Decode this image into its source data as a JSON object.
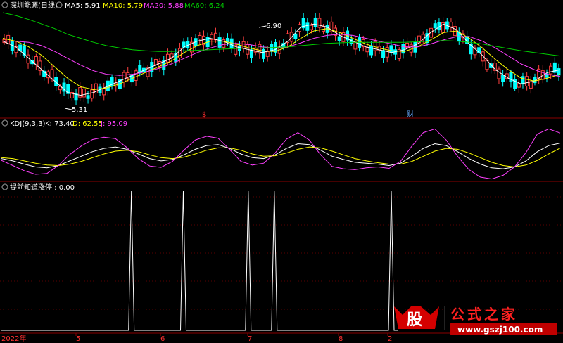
{
  "price_panel": {
    "title": "深圳能源(日线)",
    "ma5_label": "MA5: 5.91",
    "ma10_label": "MA10: 5.79",
    "ma20_label": "MA20: 5.88",
    "ma60_label": "MA60: 6.24",
    "high_marker": "6.90",
    "low_marker": "5.31",
    "event_marker_left": "$",
    "event_marker_right": "财",
    "colors": {
      "ma5": "#ffffff",
      "ma10": "#ffff00",
      "ma20": "#ff40ff",
      "ma60": "#00cc00",
      "up": "#ff4040",
      "down": "#00ffff"
    }
  },
  "kdj_panel": {
    "title": "KDJ(9,3,3)",
    "k_label": "K: 73.40",
    "d_label": "D: 62.55",
    "j_label": "J: 95.09",
    "colors": {
      "k": "#ffffff",
      "d": "#ffff00",
      "j": "#ff40ff"
    }
  },
  "signal_panel": {
    "title": "提前知道涨停 : 0.00"
  },
  "x_axis": {
    "ticks": [
      "2022年",
      "5",
      "6",
      "7",
      "8",
      "2"
    ]
  },
  "watermark": {
    "logo_char": "股",
    "text": "公式之家",
    "url": "www.gszj100.com"
  },
  "chart_data": [
    {
      "type": "line",
      "title": "深圳能源(日线)",
      "x_ticks": [
        "2022年",
        "5",
        "6",
        "7",
        "8",
        "2"
      ],
      "ylim": [
        5.2,
        7.0
      ],
      "series": [
        {
          "name": "MA5",
          "values": [
            6.5,
            6.4,
            6.2,
            6.0,
            5.8,
            5.6,
            5.55,
            5.6,
            5.7,
            5.8,
            5.9,
            6.0,
            6.1,
            6.2,
            6.4,
            6.5,
            6.55,
            6.5,
            6.4,
            6.35,
            6.3,
            6.35,
            6.5,
            6.75,
            6.8,
            6.75,
            6.6,
            6.5,
            6.4,
            6.35,
            6.3,
            6.35,
            6.45,
            6.65,
            6.8,
            6.7,
            6.45,
            6.25,
            6.0,
            5.85,
            5.75,
            5.8,
            5.95,
            6.0
          ]
        },
        {
          "name": "MA10",
          "values": [
            6.55,
            6.5,
            6.4,
            6.25,
            6.05,
            5.85,
            5.7,
            5.65,
            5.68,
            5.75,
            5.85,
            5.95,
            6.05,
            6.15,
            6.3,
            6.42,
            6.5,
            6.5,
            6.45,
            6.38,
            6.33,
            6.32,
            6.4,
            6.55,
            6.68,
            6.72,
            6.65,
            6.55,
            6.45,
            6.38,
            6.33,
            6.32,
            6.4,
            6.52,
            6.65,
            6.68,
            6.55,
            6.38,
            6.18,
            6.0,
            5.85,
            5.8,
            5.85,
            5.92
          ]
        },
        {
          "name": "MA20",
          "values": [
            6.5,
            6.5,
            6.48,
            6.42,
            6.32,
            6.2,
            6.08,
            5.98,
            5.92,
            5.9,
            5.92,
            5.96,
            6.02,
            6.1,
            6.2,
            6.3,
            6.38,
            6.44,
            6.46,
            6.44,
            6.4,
            6.38,
            6.4,
            6.47,
            6.55,
            6.6,
            6.62,
            6.6,
            6.55,
            6.5,
            6.45,
            6.4,
            6.4,
            6.45,
            6.52,
            6.58,
            6.58,
            6.5,
            6.38,
            6.24,
            6.1,
            6.0,
            5.92,
            5.88
          ]
        },
        {
          "name": "MA60",
          "values": [
            7.0,
            6.95,
            6.88,
            6.8,
            6.72,
            6.62,
            6.55,
            6.48,
            6.42,
            6.38,
            6.35,
            6.33,
            6.32,
            6.32,
            6.33,
            6.34,
            6.35,
            6.36,
            6.37,
            6.38,
            6.38,
            6.39,
            6.4,
            6.42,
            6.44,
            6.46,
            6.47,
            6.48,
            6.48,
            6.48,
            6.48,
            6.48,
            6.49,
            6.5,
            6.51,
            6.5,
            6.48,
            6.45,
            6.41,
            6.37,
            6.33,
            6.3,
            6.27,
            6.24
          ]
        }
      ]
    },
    {
      "type": "line",
      "title": "KDJ(9,3,3)",
      "ylim": [
        0,
        100
      ],
      "series": [
        {
          "name": "K",
          "values": [
            40,
            35,
            28,
            22,
            20,
            25,
            35,
            45,
            55,
            62,
            65,
            60,
            50,
            40,
            35,
            38,
            48,
            60,
            68,
            70,
            62,
            50,
            42,
            40,
            48,
            62,
            72,
            70,
            58,
            45,
            38,
            32,
            30,
            28,
            25,
            30,
            45,
            62,
            72,
            68,
            55,
            40,
            28,
            20,
            18,
            22,
            35,
            55,
            68,
            73.4
          ]
        },
        {
          "name": "D",
          "values": [
            42,
            40,
            35,
            30,
            26,
            25,
            28,
            34,
            42,
            50,
            56,
            58,
            55,
            48,
            42,
            40,
            43,
            50,
            58,
            63,
            63,
            58,
            50,
            45,
            46,
            52,
            60,
            65,
            63,
            56,
            48,
            40,
            35,
            31,
            28,
            28,
            34,
            45,
            56,
            62,
            60,
            52,
            42,
            32,
            25,
            22,
            26,
            36,
            50,
            62.55
          ]
        },
        {
          "name": "J",
          "values": [
            36,
            25,
            14,
            6,
            8,
            25,
            49,
            67,
            81,
            86,
            83,
            64,
            40,
            24,
            21,
            34,
            58,
            80,
            88,
            84,
            60,
            34,
            26,
            30,
            52,
            82,
            96,
            80,
            48,
            23,
            18,
            16,
            20,
            22,
            19,
            34,
            67,
            96,
            104,
            80,
            45,
            16,
            0,
            -4,
            4,
            22,
            53,
            93,
            104,
            95.09
          ]
        }
      ]
    },
    {
      "type": "line",
      "title": "提前知道涨停",
      "ylim": [
        0,
        1
      ],
      "series": [
        {
          "name": "提前知道涨停",
          "spike_indices": [
            10,
            14,
            19,
            21,
            30
          ]
        }
      ]
    }
  ]
}
